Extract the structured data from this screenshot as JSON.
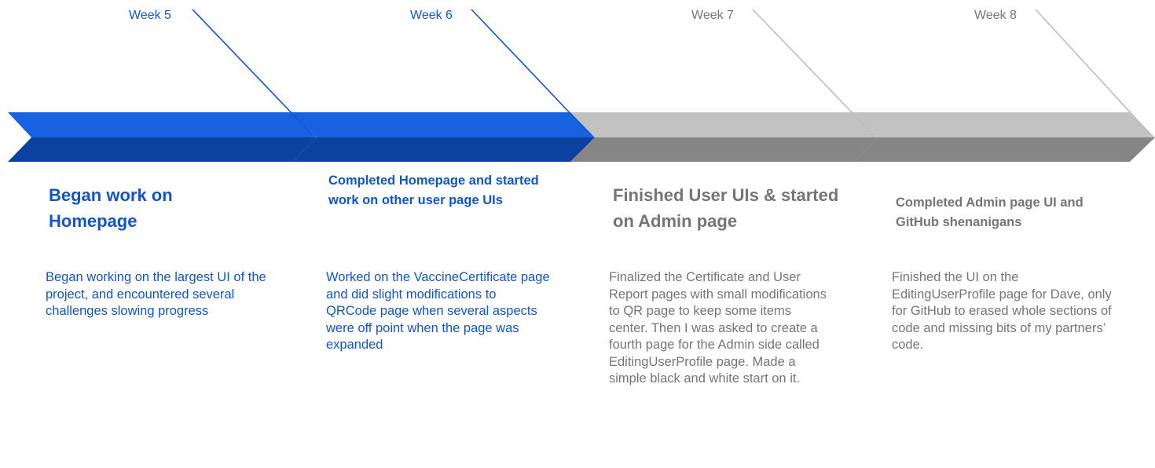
{
  "timeline": {
    "colors": {
      "active_top": "#1662e0",
      "active_bottom": "#0b42a0",
      "inactive_top": "#c2c2c2",
      "inactive_bottom": "#858585",
      "active_text": "#1155cc",
      "inactive_text": "#757575"
    },
    "milestones": [
      {
        "week": "Week 5",
        "status": "active",
        "title": "Began work on Homepage",
        "description": "Began working on the largest UI of the project, and encountered several challenges slowing progress"
      },
      {
        "week": "Week 6",
        "status": "active",
        "title": "Completed Homepage and started work on other user page UIs",
        "description": "Worked on the VaccineCertificate page and did slight modifications to QRCode page when several aspects were off point when the page was expanded"
      },
      {
        "week": "Week 7",
        "status": "inactive",
        "title": "Finished User UIs & started on Admin page",
        "description": "Finalized the Certificate and User Report pages with small modifications to QR page to keep some items center. Then I was asked to create a fourth page for the Admin side called EditingUserProfile page. Made a simple black and white start on it."
      },
      {
        "week": "Week 8",
        "status": "inactive",
        "title": "Completed Admin page UI and GitHub shenanigans",
        "description": "Finished the UI on the EditingUserProfile page for Dave, only for GitHub to erased whole sections of code and missing bits of my partners’ code."
      }
    ]
  }
}
